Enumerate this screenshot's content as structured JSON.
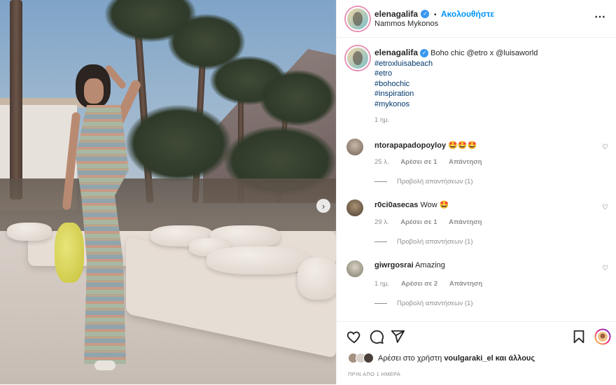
{
  "header": {
    "username": "elenagalifa",
    "separator": "•",
    "follow_label": "Ακολουθήστε",
    "location": "Nammos Mykonos",
    "more_icon": "⋯"
  },
  "caption": {
    "username": "elenagalifa",
    "text": "Boho chic @etro x @luisaworld",
    "hashtags": [
      "#etroxluisabeach",
      "#etro",
      "#bohochic",
      "#inspiration",
      "#mykonos"
    ],
    "time": "1 ημ."
  },
  "comments": [
    {
      "user": "ntorapapadopoyloy",
      "text": "🤩🤩🤩",
      "time": "25 λ.",
      "likes": "Αρέσει σε 1",
      "reply": "Απάντηση",
      "view_replies": "Προβολή απαντήσεων (1)"
    },
    {
      "user": "r0ci0asecas",
      "text": "Wow 🤩",
      "time": "29 λ.",
      "likes": "Αρέσει σε 1",
      "reply": "Απάντηση",
      "view_replies": "Προβολή απαντήσεων (1)"
    },
    {
      "user": "giwrgosrai",
      "text": "Amazing",
      "time": "1 ημ.",
      "likes": "Αρέσει σε 2",
      "reply": "Απάντηση",
      "view_replies": "Προβολή απαντήσεων (1)"
    }
  ],
  "footer": {
    "likes_prefix": "Αρέσει στο χρήστη",
    "likes_user": "voulgaraki_el",
    "likes_suffix": "και άλλους",
    "time_ago": "ΠΡΙΝ ΑΠΟ 1 ΗΜΕΡΑ"
  },
  "icons": {
    "next": "›",
    "heart_small": "♡"
  },
  "colors": {
    "link_blue": "#0095f6",
    "verified_blue": "#3897f0",
    "hashtag": "#00376b",
    "muted": "#8e8e8e"
  }
}
